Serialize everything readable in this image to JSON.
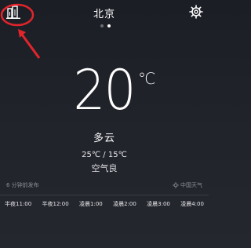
{
  "header": {
    "city": "北京",
    "left_icon": "city-list-icon",
    "right_icon": "settings-gear-icon"
  },
  "pager": {
    "pages": 2,
    "active": 2
  },
  "current": {
    "temperature": "20",
    "unit": "℃",
    "condition": "多云",
    "range": "25℃ / 15℃",
    "air_quality": "空气良"
  },
  "footer": {
    "published": "6 分钟前发布",
    "provider": "中国天气"
  },
  "hourly": [
    {
      "label": "半夜11:00"
    },
    {
      "label": "半夜12:00"
    },
    {
      "label": "凌晨1:00"
    },
    {
      "label": "凌晨2:00"
    },
    {
      "label": "凌晨3:00"
    },
    {
      "label": "凌晨4:00"
    }
  ],
  "annotation": {
    "color": "#e3242b"
  }
}
